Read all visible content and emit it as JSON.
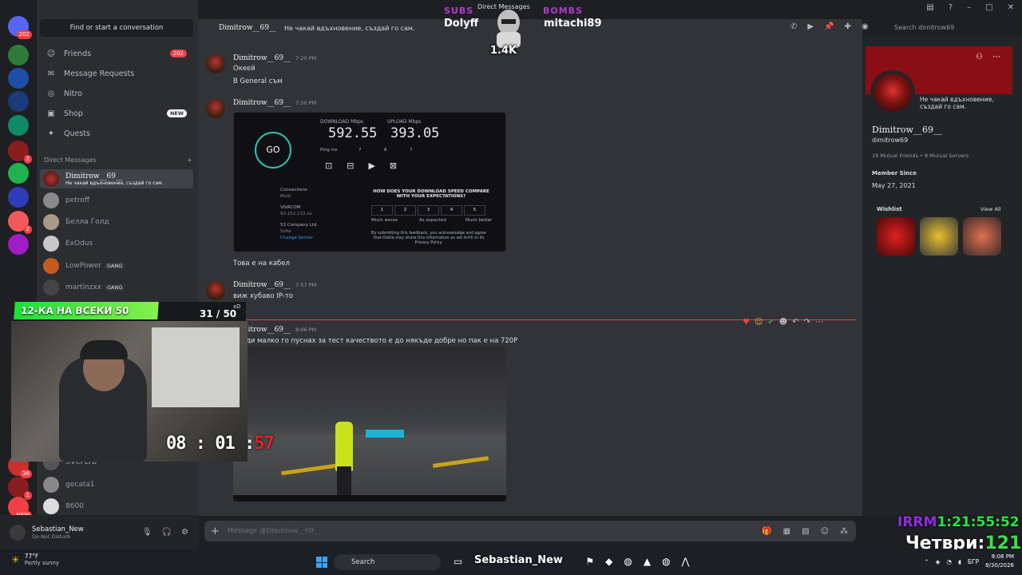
{
  "window": {
    "title": "Direct Messages"
  },
  "stream": {
    "subs_label": "SUBS",
    "bombs_label": "BOMBS",
    "subs_name": "Dolyff",
    "bombs_name": "mitachi89",
    "mascot_count": "1.4K",
    "goal_label": "12-КА НА ВСЕКИ 50",
    "goal_count": "31 / 50",
    "goal_note": "xD",
    "timer_main": "08 : 01 :",
    "timer_sec": "57",
    "irrm_label": "IRRM",
    "irrm_time": "1:21:55:52",
    "day_label": "Четври:",
    "day_number": "121"
  },
  "servers": [
    {
      "name": "home",
      "badge": "202",
      "color": "#5865f2"
    },
    {
      "name": "server-2",
      "badge": "",
      "color": "#2f7a3a"
    },
    {
      "name": "server-3",
      "badge": "",
      "color": "#1d4fa8"
    },
    {
      "name": "server-4",
      "badge": "",
      "color": "#1b3a7a"
    },
    {
      "name": "server-5",
      "badge": "",
      "color": "#0e8a64"
    },
    {
      "name": "server-6",
      "badge": "2",
      "color": "#8c1d1d"
    },
    {
      "name": "server-7",
      "badge": "",
      "color": "#1fb24e"
    },
    {
      "name": "server-8",
      "badge": "",
      "color": "#2e3cba"
    },
    {
      "name": "server-9",
      "badge": "2",
      "color": "#f05a5a"
    },
    {
      "name": "server-10",
      "badge": "",
      "color": "#a01cc6"
    },
    {
      "name": "server-11",
      "badge": "36",
      "color": "#c9302c"
    },
    {
      "name": "server-12",
      "badge": "1",
      "color": "#8a1d1d"
    },
    {
      "name": "server-new",
      "badge": "NEW",
      "color": "#f23f43"
    }
  ],
  "sidebar": {
    "search": "Find or start a conversation",
    "nav": [
      {
        "label": "Friends",
        "badge": "202",
        "icon": "friends-icon"
      },
      {
        "label": "Message Requests",
        "badge": "",
        "icon": "mail-icon"
      },
      {
        "label": "Nitro",
        "badge": "",
        "icon": "nitro-icon"
      },
      {
        "label": "Shop",
        "badge": "NEW",
        "icon": "shop-icon"
      },
      {
        "label": "Quests",
        "badge": "",
        "icon": "quests-icon"
      }
    ],
    "dm_header": "Direct Messages",
    "dms": [
      {
        "name": "Dimitrow__69__",
        "sub": "Не чакай вдъхновение, създай го сам.",
        "tag": "",
        "active": true
      },
      {
        "name": "petroff",
        "sub": "",
        "tag": ""
      },
      {
        "name": "Белла Голд",
        "sub": "",
        "tag": ""
      },
      {
        "name": "ExOdus",
        "sub": "",
        "tag": ""
      },
      {
        "name": "LowPower",
        "sub": "",
        "tag": "GANG"
      },
      {
        "name": "martinzxx",
        "sub": "",
        "tag": "GANG"
      },
      {
        "name": "ЭVЄΓLYB",
        "sub": "",
        "tag": ""
      },
      {
        "name": "gecata1",
        "sub": "",
        "tag": ""
      },
      {
        "name": "8600",
        "sub": "",
        "tag": ""
      }
    ]
  },
  "user": {
    "name": "Sebastian_New",
    "status": "Do Not Disturb"
  },
  "header": {
    "name": "Dimitrow__69__",
    "status": "Не чакай вдъхновение, създай го сам.",
    "search_placeholder": "Search dimitrow69"
  },
  "messages": [
    {
      "author": "Dimitrow__69__",
      "time": "7:20 PM",
      "lines": [
        "Океей",
        "В General съм"
      ]
    },
    {
      "author": "Dimitrow__69__",
      "time": "7:50 PM",
      "lines": [
        "Това е на кабел"
      ]
    },
    {
      "author": "Dimitrow__69__",
      "time": "7:57 PM",
      "lines": [
        "виж хубаво IP-то"
      ]
    },
    {
      "author": "Dimitrow__69__",
      "time": "8:06 PM",
      "lines": [
        "ди малко го пуснах за тест качеството е до някъде добре но пак е на 720P"
      ]
    }
  ],
  "speedtest": {
    "go": "GO",
    "download_label": "DOWNLOAD Mbps",
    "download": "592.55",
    "upload_label": "UPLOAD Mbps",
    "upload": "393.05",
    "ping_label": "Ping ms",
    "ping": "7",
    "jitter_dl": "8",
    "jitter_ul": "7",
    "connections": "Connections",
    "connections_val": "Multi",
    "isp": "VIVACOM",
    "isp_ip": "93.152.172.xx",
    "server": "S3 Company Ltd.",
    "server_city": "Sofia",
    "change": "Change Server",
    "question": "HOW DOES YOUR DOWNLOAD SPEED COMPARE WITH YOUR EXPECTATIONS?",
    "scale": [
      "1",
      "2",
      "3",
      "4",
      "5"
    ],
    "worse": "Much worse",
    "expected": "As expected",
    "better": "Much better",
    "disclaimer": "By submitting this feedback, you acknowledge and agree that Ookla may share this information as set forth in its Privacy Policy."
  },
  "composer": {
    "placeholder_prefix": "Message @",
    "placeholder_name": "Dimitrow__69__"
  },
  "profile": {
    "status": "Не чакай вдъхновение, създай го сам.",
    "display_name": "Dimitrow__69__",
    "username": "dimitrow69",
    "mutual_friends": "19 Mutual Friends",
    "mutual_servers": "8 Mutual Servers",
    "member_since_label": "Member Since",
    "member_since": "May 27, 2021",
    "wishlist_label": "Wishlist",
    "view_all": "View All"
  },
  "taskbar": {
    "temp": "77°F",
    "weather": "Partly sunny",
    "search": "Search",
    "stream_name": "Sebastian_New",
    "lang": "БГР",
    "time": "8:08 PM",
    "date": "8/30/2026"
  },
  "colors": {
    "accent": "#5865f2",
    "danger": "#f23f43",
    "bg": "#313338",
    "goal": "#1ce036"
  }
}
